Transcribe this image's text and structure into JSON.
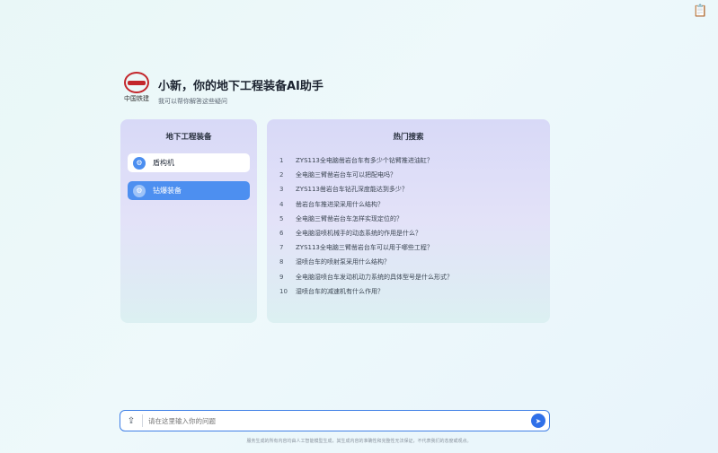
{
  "toolbar": {
    "icon": "clipboard-icon"
  },
  "header": {
    "logo_text": "中国铁建",
    "title": "小新，你的地下工程装备AI助手",
    "subtitle": "我可以帮你解答这些疑问"
  },
  "equipment": {
    "title": "地下工程装备",
    "items": [
      {
        "label": "盾构机",
        "icon": "machine-icon"
      },
      {
        "label": "钻爆装备",
        "icon": "drill-icon"
      }
    ]
  },
  "hot": {
    "title": "热门搜索",
    "items": [
      {
        "num": "1",
        "text": "ZYS113全电脑凿岩台车有多少个钻臂推进油缸？"
      },
      {
        "num": "2",
        "text": "全电脑三臂凿岩台车可以把配电吗？"
      },
      {
        "num": "3",
        "text": "ZYS113凿岩台车钻孔深度能达到多少？"
      },
      {
        "num": "4",
        "text": "凿岩台车推进梁采用什么结构？"
      },
      {
        "num": "5",
        "text": "全电脑三臂凿岩台车怎样实现定位的？"
      },
      {
        "num": "6",
        "text": "全电脑湿喷机械手的动态系统的作用是什么？"
      },
      {
        "num": "7",
        "text": "ZYS113全电脑三臂凿岩台车可以用于哪些工程？"
      },
      {
        "num": "8",
        "text": "湿喷台车的喷射泵采用什么结构？"
      },
      {
        "num": "9",
        "text": "全电脑湿喷台车发动机动力系统的具体型号是什么形式？"
      },
      {
        "num": "10",
        "text": "湿喷台车的减速机有什么作用？"
      }
    ]
  },
  "input": {
    "placeholder": "请在这里输入你的问题",
    "upload_icon": "upload-icon",
    "send_icon": "send-icon"
  },
  "footer": {
    "text": "服务生成的所有内容均由人工智能模型生成，其生成内容的准确性和完整性无法保证，不代表我们的态度或观点。"
  }
}
